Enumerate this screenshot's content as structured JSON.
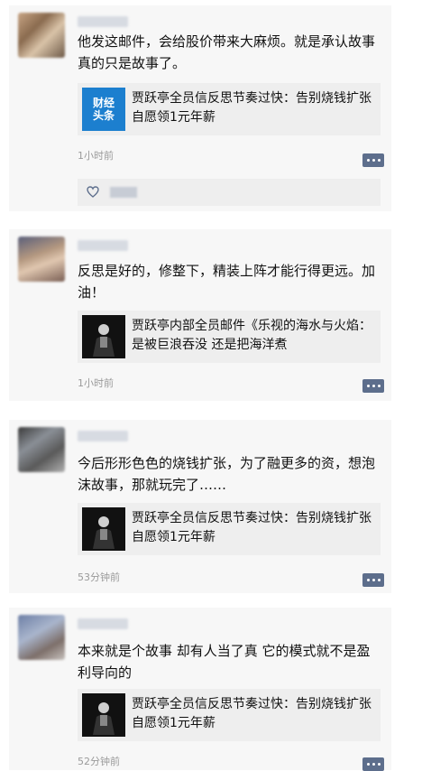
{
  "comments": [
    {
      "text": "他发这邮件，会给股价带来大麻烦。就是承认故事真的只是故事了。",
      "share": {
        "title": "贾跃亭全员信反思节奏过快：告别烧钱扩张 自愿领1元年薪",
        "thumb": "caijing-toutiao-logo",
        "logo_line1": "财经",
        "logo_line2": "头条"
      },
      "time": "1小时前"
    },
    {
      "text": "反思是好的，修整下，精装上阵才能行得更远。加油！",
      "share": {
        "title": "贾跃亭内部全员邮件《乐视的海水与火焰：是被巨浪吞没 还是把海洋煮",
        "thumb": "person-speaking-photo"
      },
      "time": "1小时前"
    },
    {
      "text": "今后形形色色的烧钱扩张，为了融更多的资，想泡沫故事，那就玩完了……",
      "share": {
        "title": "贾跃亭全员信反思节奏过快：告别烧钱扩张 自愿领1元年薪",
        "thumb": "person-speaking-photo"
      },
      "time": "53分钟前"
    },
    {
      "text": "本来就是个故事 却有人当了真  它的模式就不是盈利导向的",
      "share": {
        "title": "贾跃亭全员信反思节奏过快：告别烧钱扩张 自愿领1元年薪",
        "thumb": "person-speaking-photo"
      },
      "time": "52分钟前"
    }
  ],
  "colors": {
    "card_bg": "#f7f7f7",
    "share_bg": "#eeeeee",
    "more_button": "#5d6e8c",
    "time": "#9a9a9a"
  }
}
